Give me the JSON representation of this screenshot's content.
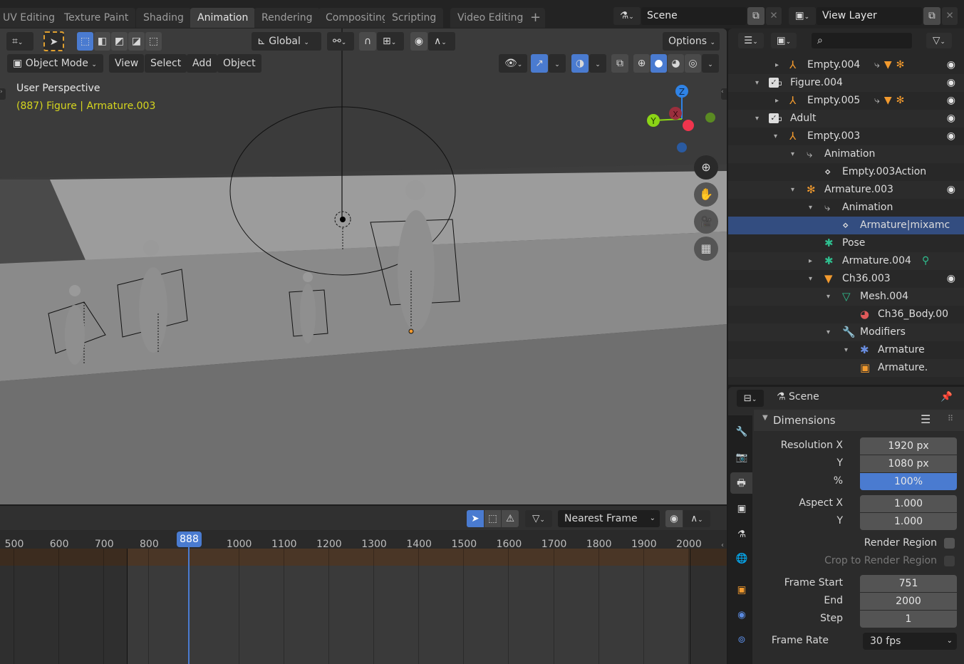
{
  "workspace_tabs": [
    "UV Editing",
    "Texture Paint",
    "Shading",
    "Animation",
    "Rendering",
    "Compositing",
    "Scripting",
    "Video Editing"
  ],
  "active_tab": "Animation",
  "add_tab_label": "+",
  "scene_selector": {
    "value": "Scene"
  },
  "view_layer_selector": {
    "value": "View Layer"
  },
  "viewport": {
    "transform_orientation": "Global",
    "options_label": "Options",
    "mode": "Object Mode",
    "menus": [
      "View",
      "Select",
      "Add",
      "Object"
    ],
    "view_name": "User Perspective",
    "object_info": "(887) Figure | Armature.003",
    "gizmo_axes": {
      "z": "Z",
      "y": "Y",
      "x": "X"
    },
    "colors": {
      "z": "#2f83e6",
      "y": "#8bd416",
      "x": "#f0344d",
      "info_text": "#d6d61e"
    }
  },
  "outliner": {
    "rows": [
      {
        "label": "Empty.004",
        "icon": "empty-icon",
        "extras": [
          "action",
          "mesh",
          "armature"
        ],
        "eye": true
      },
      {
        "label": "Figure.004",
        "icon": "collection-icon",
        "checkbox": true,
        "eye": true
      },
      {
        "label": "Empty.005",
        "icon": "empty-icon",
        "extras": [
          "action",
          "mesh",
          "armature"
        ],
        "eye": true
      },
      {
        "label": "Adult",
        "icon": "collection-icon",
        "checkbox": true,
        "eye": true
      },
      {
        "label": "Empty.003",
        "icon": "empty-icon",
        "eye": true
      },
      {
        "label": "Animation",
        "icon": "animation-icon"
      },
      {
        "label": "Empty.003Action",
        "icon": "action-icon"
      },
      {
        "label": "Armature.003",
        "icon": "armature-icon",
        "eye": true
      },
      {
        "label": "Animation",
        "icon": "animation-icon"
      },
      {
        "label": "Armature|mixamc",
        "icon": "action-icon",
        "selected": true
      },
      {
        "label": "Pose",
        "icon": "pose-icon"
      },
      {
        "label": "Armature.004",
        "icon": "armature-data-icon"
      },
      {
        "label": "Ch36.003",
        "icon": "mesh-object-icon",
        "eye": true
      },
      {
        "label": "Mesh.004",
        "icon": "mesh-data-icon"
      },
      {
        "label": "Ch36_Body.00",
        "icon": "material-icon"
      },
      {
        "label": "Modifiers",
        "icon": "wrench-icon"
      },
      {
        "label": "Armature",
        "icon": "armature-modifier-icon"
      },
      {
        "label": "Armature.",
        "icon": "object-icon"
      }
    ]
  },
  "properties": {
    "context": "Scene",
    "panel": "Dimensions",
    "resolution_x_label": "Resolution X",
    "resolution_x": "1920 px",
    "resolution_y_label": "Y",
    "resolution_y": "1080 px",
    "percent_label": "%",
    "percent": "100%",
    "aspect_x_label": "Aspect X",
    "aspect_x": "1.000",
    "aspect_y_label": "Y",
    "aspect_y": "1.000",
    "render_region_label": "Render Region",
    "crop_label": "Crop to Render Region",
    "frame_start_label": "Frame Start",
    "frame_start": "751",
    "frame_end_label": "End",
    "frame_end": "2000",
    "frame_step_label": "Step",
    "frame_step": "1",
    "frame_rate_label": "Frame Rate",
    "frame_rate": "30 fps"
  },
  "timeline": {
    "snap_mode": "Nearest Frame",
    "current_frame": "888",
    "ticks": [
      "500",
      "600",
      "700",
      "800",
      "1000",
      "1100",
      "1200",
      "1300",
      "1400",
      "1500",
      "1600",
      "1700",
      "1800",
      "1900",
      "2000"
    ]
  }
}
